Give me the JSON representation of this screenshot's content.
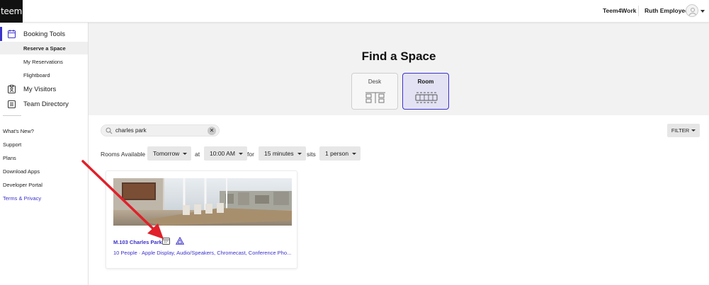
{
  "header": {
    "logo_text": "teem",
    "org_name": "Teem4Work",
    "user_name": "Ruth Employee"
  },
  "sidebar": {
    "booking": {
      "label": "Booking Tools",
      "subitems": [
        {
          "label": "Reserve a Space",
          "selected": true
        },
        {
          "label": "My Reservations",
          "selected": false
        },
        {
          "label": "Flightboard",
          "selected": false
        }
      ]
    },
    "visitors_label": "My Visitors",
    "directory_label": "Team Directory",
    "links": [
      {
        "label": "What's New?"
      },
      {
        "label": "Support"
      },
      {
        "label": "Plans"
      },
      {
        "label": "Download Apps"
      },
      {
        "label": "Developer Portal"
      },
      {
        "label": "Terms & Privacy"
      }
    ]
  },
  "main": {
    "title": "Find a Space",
    "space_types": [
      {
        "label": "Desk",
        "icon": "desk-icon",
        "selected": false
      },
      {
        "label": "Room",
        "icon": "room-icon",
        "selected": true
      }
    ],
    "search": {
      "value": "charles park"
    },
    "filter_label": "FILTER",
    "query": {
      "rooms_available_label": "Rooms Available",
      "day": "Tomorrow",
      "at_label": "at",
      "time": "10:00 AM",
      "for_label": "for",
      "duration": "15 minutes",
      "sits_label": "sits",
      "capacity": "1 person"
    },
    "results": [
      {
        "name": "M.103 Charles Park",
        "features": "10 People · Apple Display, Audio/Speakers, Chromecast, Conference Pho..."
      }
    ]
  },
  "colors": {
    "accent": "#3b32c8",
    "annotation_arrow": "#e0202a",
    "hero_bg": "#f2f2f2"
  }
}
